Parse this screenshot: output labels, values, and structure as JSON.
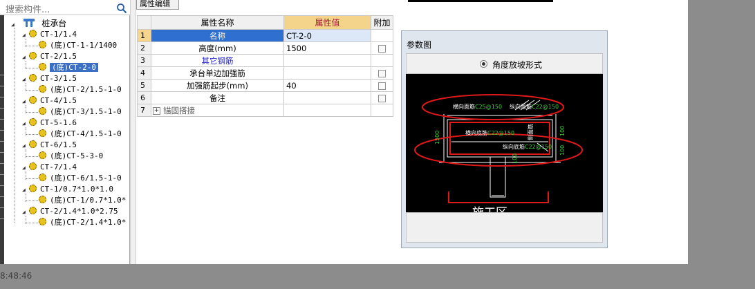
{
  "search": {
    "placeholder": "搜索构件..."
  },
  "tree": {
    "root": "桩承台",
    "items": [
      {
        "label": "CT-1/1.4",
        "child": "(底)CT-1-1/1400"
      },
      {
        "label": "CT-2/1.5",
        "child": "(底)CT-2-0",
        "child_selected": true
      },
      {
        "label": "CT-3/1.5",
        "child": "(底)CT-2/1.5-1-0"
      },
      {
        "label": "CT-4/1.5",
        "child": "(底)CT-3/1.5-1-0"
      },
      {
        "label": "CT-5-1.6",
        "child": "(底)CT-4/1.5-1-0"
      },
      {
        "label": "CT-6/1.5",
        "child": "(底)CT-5-3-0"
      },
      {
        "label": "CT-7/1.4",
        "child": "(底)CT-6/1.5-1-0"
      },
      {
        "label": "CT-1/0.7*1.0*1.0",
        "child": "(底)CT-1/0.7*1.0*"
      },
      {
        "label": "CT-2/1.4*1.0*2.75",
        "child": "(底)CT-2/1.4*1.0*"
      }
    ]
  },
  "tab": {
    "label": "属性编辑"
  },
  "grid": {
    "headers": {
      "name": "属性名称",
      "value": "属性值",
      "extra": "附加"
    },
    "rows": [
      {
        "num": "1",
        "name": "名称",
        "value": "CT-2-0",
        "checkbox": false
      },
      {
        "num": "2",
        "name": "高度(mm)",
        "value": "1500",
        "checkbox": true
      },
      {
        "num": "3",
        "name": "其它钢筋",
        "value": "",
        "checkbox": false
      },
      {
        "num": "4",
        "name": "承台单边加强筋",
        "value": "",
        "checkbox": true
      },
      {
        "num": "5",
        "name": "加强筋起步(mm)",
        "value": "40",
        "checkbox": true
      },
      {
        "num": "6",
        "name": "备注",
        "value": "",
        "checkbox": true
      },
      {
        "num": "7",
        "name": "锚固搭接",
        "value": "",
        "checkbox": false
      }
    ]
  },
  "param": {
    "title": "参数图",
    "radio_label": "角度放坡形式",
    "drawing": {
      "top_h": "横向面筋",
      "top_h_val": "C25@150",
      "top_v": "纵向面筋",
      "top_v_val": "C22@150",
      "bot_h": "横向底筋",
      "bot_h_val": "C22@150",
      "bot_v": "纵向底筋",
      "bot_v_val": "C22@150",
      "dim_left": "1500",
      "dim_r1": "100",
      "dim_r2": "100",
      "dim_mid": "100",
      "side": "侧面筋",
      "bottom_text": "施工区"
    }
  },
  "statusbar": {
    "time": "8:48:46"
  },
  "colors": {
    "selection": "#2f6fd0",
    "header_value": "#f4d38a",
    "highlight_red": "#e01818"
  }
}
